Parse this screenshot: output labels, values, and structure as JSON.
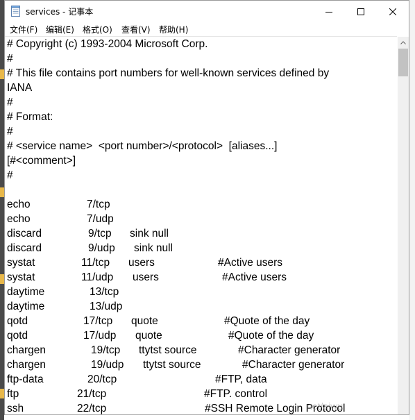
{
  "window": {
    "title": "services - 记事本",
    "app_icon": "notepad-icon",
    "controls": {
      "minimize_icon": "minimize-icon",
      "maximize_icon": "maximize-icon",
      "close_icon": "close-icon"
    }
  },
  "menu": [
    "文件(F)",
    "编辑(E)",
    "格式(O)",
    "查看(V)",
    "帮助(H)"
  ],
  "content": {
    "lines": [
      [
        "# Copyright (c) 1993-2004 Microsoft Corp."
      ],
      [
        "#"
      ],
      [
        "# This file contains port numbers for well-known services defined by"
      ],
      [
        "IANA"
      ],
      [
        "#"
      ],
      [
        "# Format:"
      ],
      [
        "#"
      ],
      [
        "# <service name>  <port number>/<protocol>  [aliases...]"
      ],
      [
        "[#<comment>]"
      ],
      [
        "#"
      ],
      [
        ""
      ],
      [
        "echo",
        "7/tcp"
      ],
      [
        "echo",
        "7/udp"
      ],
      [
        "discard",
        "9/tcp",
        "sink null"
      ],
      [
        "discard",
        "9/udp",
        "sink null"
      ],
      [
        "systat",
        "11/tcp",
        "users",
        "#Active users"
      ],
      [
        "systat",
        "11/udp",
        "users",
        "#Active users"
      ],
      [
        "daytime",
        "13/tcp"
      ],
      [
        "daytime",
        "13/udp"
      ],
      [
        "qotd",
        "17/tcp",
        "quote",
        "#Quote of the day"
      ],
      [
        "qotd",
        "17/udp",
        "quote",
        "#Quote of the day"
      ],
      [
        "chargen",
        "19/tcp",
        "ttytst source",
        "#Character generator"
      ],
      [
        "chargen",
        "19/udp",
        "ttytst source",
        "#Character generator"
      ],
      [
        "ftp-data",
        "20/tcp",
        "",
        "#FTP, data"
      ],
      [
        "ftp",
        "21/tcp",
        "",
        "#FTP. control"
      ],
      [
        "ssh",
        "22/tcp",
        "",
        "#SSH Remote Login Protocol"
      ]
    ]
  },
  "watermark": "net/aiwu",
  "colors": {
    "scroll_thumb": "#c2c2c2",
    "scroll_track": "#f0f0f0"
  }
}
